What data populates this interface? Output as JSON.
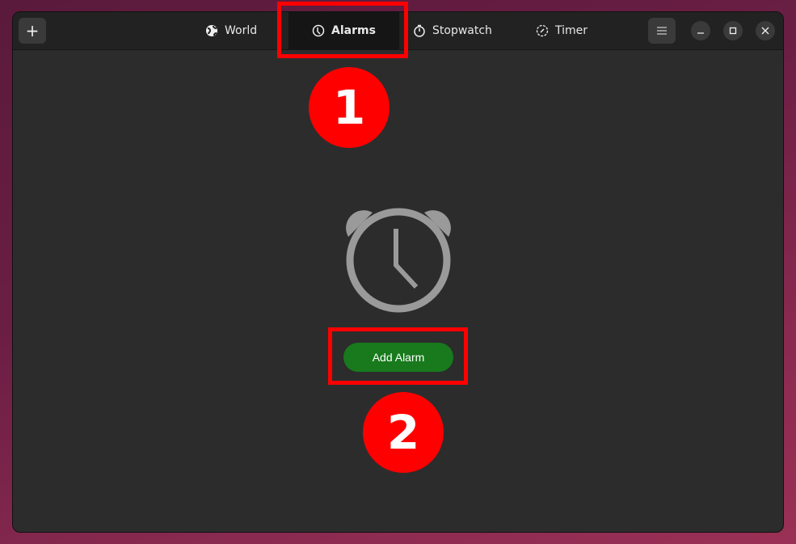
{
  "header": {
    "new_button": "+",
    "tabs": [
      {
        "label": "World",
        "icon": "globe-icon"
      },
      {
        "label": "Alarms",
        "icon": "clock-icon",
        "active": true
      },
      {
        "label": "Stopwatch",
        "icon": "stopwatch-icon"
      },
      {
        "label": "Timer",
        "icon": "timer-icon"
      }
    ]
  },
  "main": {
    "empty_icon": "alarm-clock-icon",
    "add_alarm_label": "Add Alarm"
  },
  "annotations": [
    {
      "label": "1"
    },
    {
      "label": "2"
    }
  ],
  "colors": {
    "accent": "#187a1c",
    "annotation": "#ff0000"
  }
}
